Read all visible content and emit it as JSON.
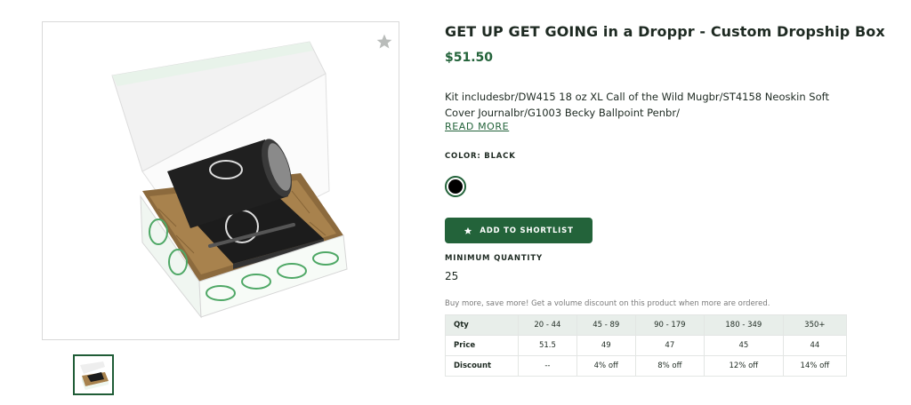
{
  "product": {
    "title": "GET UP GET GOING in a Droppr - Custom Dropship Box",
    "price": "$51.50",
    "description": "Kit includesbr/DW415 18 oz XL Call of the Wild Mugbr/ST4158 Neoskin Soft Cover Journalbr/G1003 Becky Ballpoint Penbr/",
    "read_more": "READ MORE",
    "color_label": "COLOR: BLACK",
    "selected_color": "#000000",
    "shortlist_button": "ADD TO SHORTLIST",
    "min_quantity_label": "MINIMUM QUANTITY",
    "min_quantity": "25",
    "volume_note": "Buy more, save more! Get a volume discount on this product when more are ordered."
  },
  "pricing_table": {
    "rows": [
      {
        "label": "Qty",
        "cells": [
          "20 - 44",
          "45 - 89",
          "90 - 179",
          "180 - 349",
          "350+"
        ]
      },
      {
        "label": "Price",
        "cells": [
          "51.5",
          "49",
          "47",
          "45",
          "44"
        ]
      },
      {
        "label": "Discount",
        "cells": [
          "--",
          "4% off",
          "8% off",
          "12% off",
          "14% off"
        ]
      }
    ]
  },
  "colors": {
    "brand_green": "#23633a",
    "table_header": "#e8eeea"
  },
  "icons": {
    "favorite": "star-icon",
    "shortlist": "star-icon"
  }
}
